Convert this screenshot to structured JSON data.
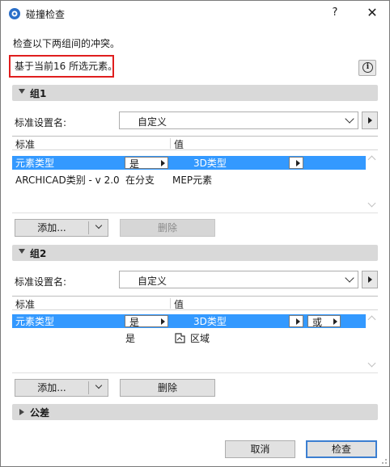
{
  "window": {
    "title": "碰撞检查",
    "help": "?",
    "close": "✕"
  },
  "intro": "检查以下两组间的冲突。",
  "basis": "基于当前16 所选元素。",
  "info_icon": "i",
  "group1": {
    "title": "组1",
    "preset_label": "标准设置名:",
    "preset_value": "自定义",
    "table": {
      "headers": [
        "标准",
        "值"
      ],
      "rows": [
        {
          "criterion": "元素类型",
          "op": "是",
          "value": "3D类型",
          "selected": true
        },
        {
          "criterion": "ARCHICAD类别 - v 2.0",
          "op": "在分支",
          "value": "MEP元素",
          "selected": false
        }
      ]
    },
    "add_label": "添加...",
    "delete_label": "删除"
  },
  "group2": {
    "title": "组2",
    "preset_label": "标准设置名:",
    "preset_value": "自定义",
    "table": {
      "headers": [
        "标准",
        "值"
      ],
      "rows": [
        {
          "criterion": "元素类型",
          "op": "是",
          "value": "3D类型",
          "logic": "或",
          "selected": true
        },
        {
          "criterion": "",
          "op": "是",
          "value": "区域",
          "value_icon": "zone-icon",
          "selected": false
        }
      ]
    },
    "add_label": "添加...",
    "delete_label": "删除"
  },
  "tolerance": {
    "title": "公差"
  },
  "footer": {
    "cancel": "取消",
    "check": "检查"
  },
  "colors": {
    "selection": "#3399ff",
    "highlight_border": "#e01e1e",
    "group_header": "#d9d9d9"
  }
}
